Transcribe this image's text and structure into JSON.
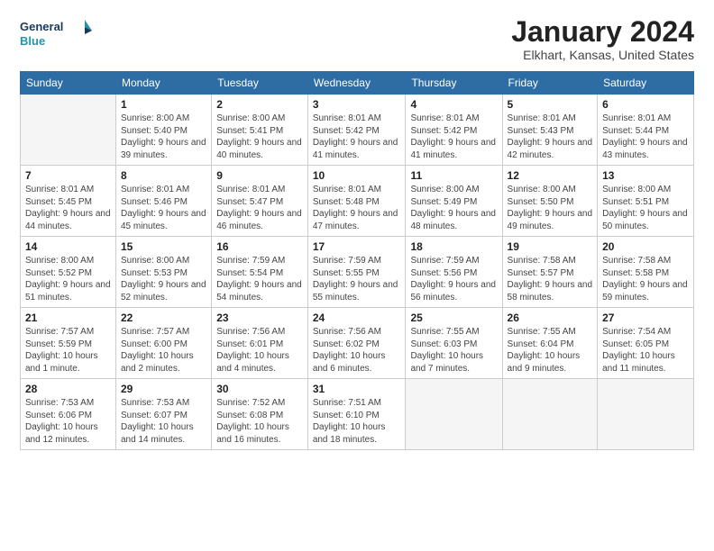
{
  "logo": {
    "line1": "General",
    "line2": "Blue"
  },
  "title": "January 2024",
  "subtitle": "Elkhart, Kansas, United States",
  "days_of_week": [
    "Sunday",
    "Monday",
    "Tuesday",
    "Wednesday",
    "Thursday",
    "Friday",
    "Saturday"
  ],
  "weeks": [
    [
      {
        "day": "",
        "empty": true
      },
      {
        "day": "1",
        "sunrise": "8:00 AM",
        "sunset": "5:40 PM",
        "daylight": "9 hours and 39 minutes."
      },
      {
        "day": "2",
        "sunrise": "8:00 AM",
        "sunset": "5:41 PM",
        "daylight": "9 hours and 40 minutes."
      },
      {
        "day": "3",
        "sunrise": "8:01 AM",
        "sunset": "5:42 PM",
        "daylight": "9 hours and 41 minutes."
      },
      {
        "day": "4",
        "sunrise": "8:01 AM",
        "sunset": "5:42 PM",
        "daylight": "9 hours and 41 minutes."
      },
      {
        "day": "5",
        "sunrise": "8:01 AM",
        "sunset": "5:43 PM",
        "daylight": "9 hours and 42 minutes."
      },
      {
        "day": "6",
        "sunrise": "8:01 AM",
        "sunset": "5:44 PM",
        "daylight": "9 hours and 43 minutes."
      }
    ],
    [
      {
        "day": "7",
        "sunrise": "8:01 AM",
        "sunset": "5:45 PM",
        "daylight": "9 hours and 44 minutes."
      },
      {
        "day": "8",
        "sunrise": "8:01 AM",
        "sunset": "5:46 PM",
        "daylight": "9 hours and 45 minutes."
      },
      {
        "day": "9",
        "sunrise": "8:01 AM",
        "sunset": "5:47 PM",
        "daylight": "9 hours and 46 minutes."
      },
      {
        "day": "10",
        "sunrise": "8:01 AM",
        "sunset": "5:48 PM",
        "daylight": "9 hours and 47 minutes."
      },
      {
        "day": "11",
        "sunrise": "8:00 AM",
        "sunset": "5:49 PM",
        "daylight": "9 hours and 48 minutes."
      },
      {
        "day": "12",
        "sunrise": "8:00 AM",
        "sunset": "5:50 PM",
        "daylight": "9 hours and 49 minutes."
      },
      {
        "day": "13",
        "sunrise": "8:00 AM",
        "sunset": "5:51 PM",
        "daylight": "9 hours and 50 minutes."
      }
    ],
    [
      {
        "day": "14",
        "sunrise": "8:00 AM",
        "sunset": "5:52 PM",
        "daylight": "9 hours and 51 minutes."
      },
      {
        "day": "15",
        "sunrise": "8:00 AM",
        "sunset": "5:53 PM",
        "daylight": "9 hours and 52 minutes."
      },
      {
        "day": "16",
        "sunrise": "7:59 AM",
        "sunset": "5:54 PM",
        "daylight": "9 hours and 54 minutes."
      },
      {
        "day": "17",
        "sunrise": "7:59 AM",
        "sunset": "5:55 PM",
        "daylight": "9 hours and 55 minutes."
      },
      {
        "day": "18",
        "sunrise": "7:59 AM",
        "sunset": "5:56 PM",
        "daylight": "9 hours and 56 minutes."
      },
      {
        "day": "19",
        "sunrise": "7:58 AM",
        "sunset": "5:57 PM",
        "daylight": "9 hours and 58 minutes."
      },
      {
        "day": "20",
        "sunrise": "7:58 AM",
        "sunset": "5:58 PM",
        "daylight": "9 hours and 59 minutes."
      }
    ],
    [
      {
        "day": "21",
        "sunrise": "7:57 AM",
        "sunset": "5:59 PM",
        "daylight": "10 hours and 1 minute."
      },
      {
        "day": "22",
        "sunrise": "7:57 AM",
        "sunset": "6:00 PM",
        "daylight": "10 hours and 2 minutes."
      },
      {
        "day": "23",
        "sunrise": "7:56 AM",
        "sunset": "6:01 PM",
        "daylight": "10 hours and 4 minutes."
      },
      {
        "day": "24",
        "sunrise": "7:56 AM",
        "sunset": "6:02 PM",
        "daylight": "10 hours and 6 minutes."
      },
      {
        "day": "25",
        "sunrise": "7:55 AM",
        "sunset": "6:03 PM",
        "daylight": "10 hours and 7 minutes."
      },
      {
        "day": "26",
        "sunrise": "7:55 AM",
        "sunset": "6:04 PM",
        "daylight": "10 hours and 9 minutes."
      },
      {
        "day": "27",
        "sunrise": "7:54 AM",
        "sunset": "6:05 PM",
        "daylight": "10 hours and 11 minutes."
      }
    ],
    [
      {
        "day": "28",
        "sunrise": "7:53 AM",
        "sunset": "6:06 PM",
        "daylight": "10 hours and 12 minutes."
      },
      {
        "day": "29",
        "sunrise": "7:53 AM",
        "sunset": "6:07 PM",
        "daylight": "10 hours and 14 minutes."
      },
      {
        "day": "30",
        "sunrise": "7:52 AM",
        "sunset": "6:08 PM",
        "daylight": "10 hours and 16 minutes."
      },
      {
        "day": "31",
        "sunrise": "7:51 AM",
        "sunset": "6:10 PM",
        "daylight": "10 hours and 18 minutes."
      },
      {
        "day": "",
        "empty": true
      },
      {
        "day": "",
        "empty": true
      },
      {
        "day": "",
        "empty": true
      }
    ]
  ]
}
